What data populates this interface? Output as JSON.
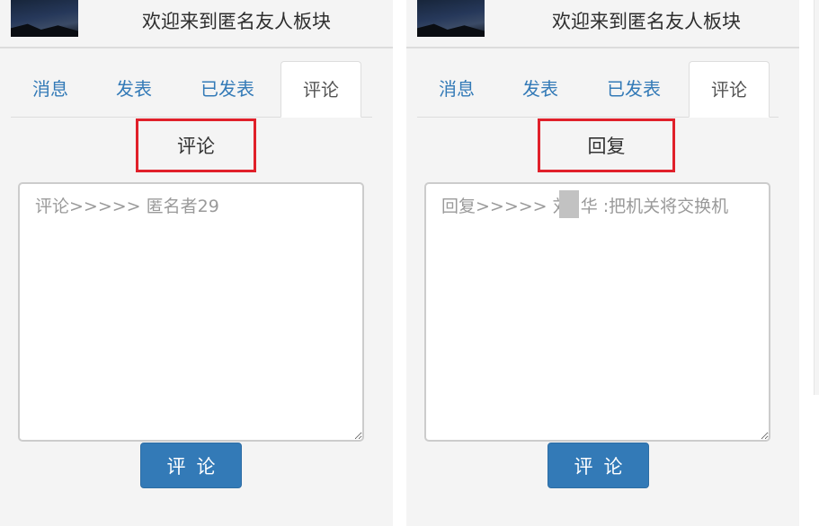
{
  "panels": [
    {
      "header": {
        "welcome": "欢迎来到匿名友人板块"
      },
      "tabs": [
        "消息",
        "发表",
        "已发表",
        "评论"
      ],
      "active_tab": "评论",
      "section_title": "评论",
      "textarea": {
        "placeholder": "评论>>>>> 匿名者29",
        "value": ""
      },
      "submit_label": "评论"
    },
    {
      "header": {
        "welcome": "欢迎来到匿名友人板块"
      },
      "tabs": [
        "消息",
        "发表",
        "已发表",
        "评论"
      ],
      "active_tab": "评论",
      "section_title": "回复",
      "textarea": {
        "placeholder": "回复>>>>> 刘  华 :把机关将交换机",
        "value": ""
      },
      "submit_label": "评论"
    }
  ],
  "colors": {
    "accent": "#337ab7",
    "highlight_border": "#e0202a",
    "background": "#f4f4f4"
  },
  "icons": {
    "avatar": "avatar-image"
  }
}
